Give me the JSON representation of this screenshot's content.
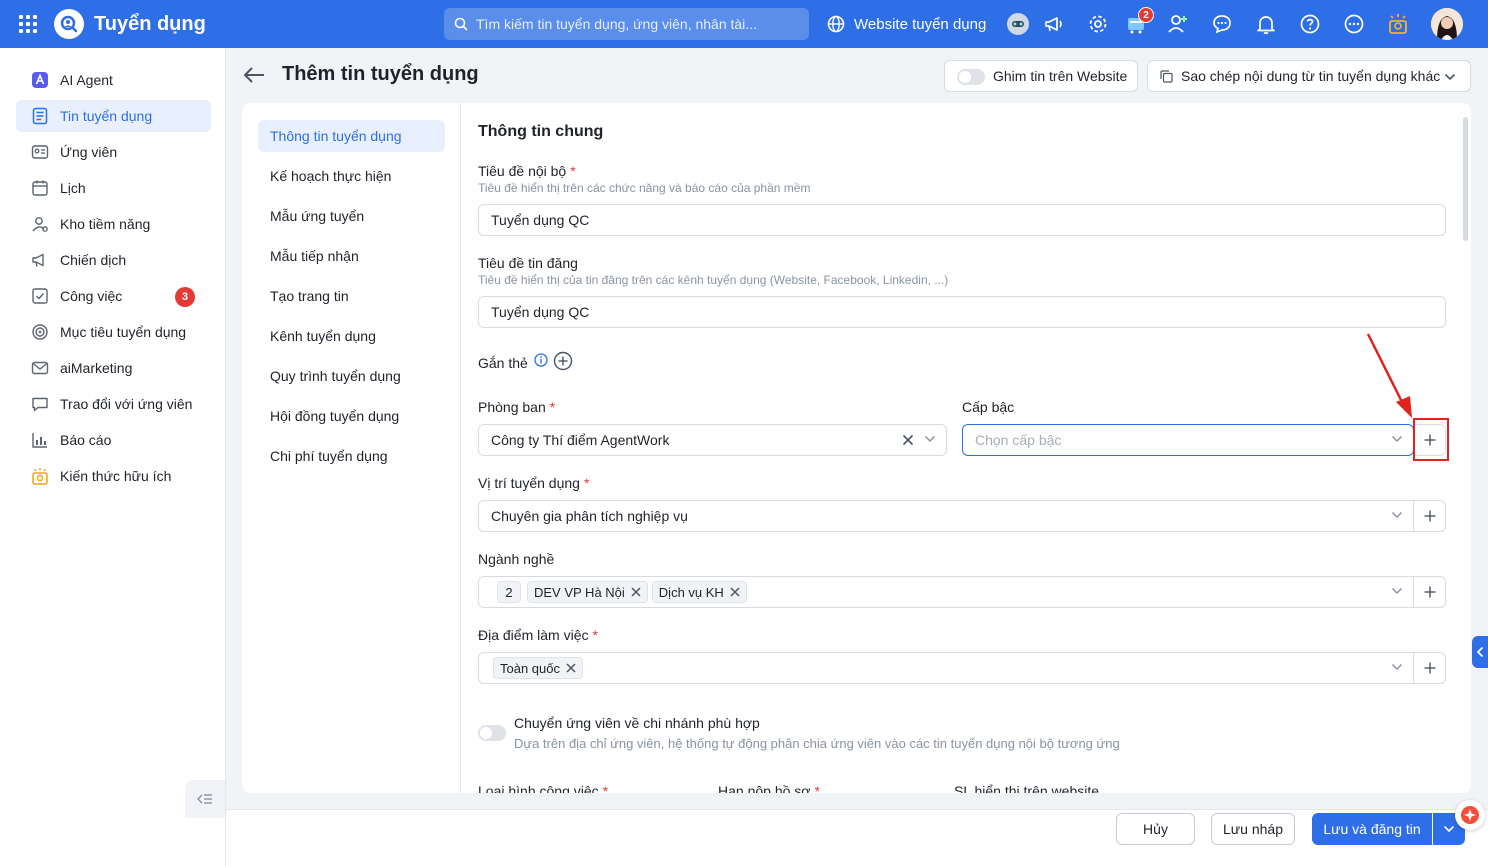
{
  "app": {
    "title": "Tuyển dụng"
  },
  "topbar": {
    "search_placeholder": "Tìm kiếm tin tuyển dụng, ứng viên, nhân tài...",
    "website_label": "Website tuyển dụng",
    "cart_badge": "2"
  },
  "sidebar": {
    "items": [
      {
        "label": "AI Agent",
        "icon": "ai-agent-icon"
      },
      {
        "label": "Tin tuyển dụng",
        "icon": "job-post-icon",
        "active": true
      },
      {
        "label": "Ứng viên",
        "icon": "candidate-icon"
      },
      {
        "label": "Lịch",
        "icon": "calendar-icon"
      },
      {
        "label": "Kho tiềm năng",
        "icon": "talent-pool-icon"
      },
      {
        "label": "Chiến dịch",
        "icon": "megaphone-icon"
      },
      {
        "label": "Công việc",
        "icon": "task-icon",
        "badge": "3"
      },
      {
        "label": "Mục tiêu tuyển dụng",
        "icon": "target-icon"
      },
      {
        "label": "aiMarketing",
        "icon": "mail-icon"
      },
      {
        "label": "Trao đổi với ứng viên",
        "icon": "chat-icon"
      },
      {
        "label": "Báo cáo",
        "icon": "report-icon"
      },
      {
        "label": "Kiến thức hữu ích",
        "icon": "lightbulb-icon"
      }
    ]
  },
  "header": {
    "title": "Thêm tin tuyển dụng",
    "pin_label": "Ghim tin trên Website",
    "copy_label": "Sao chép nội dung từ tin tuyển dụng khác"
  },
  "steps": [
    "Thông tin tuyển dụng",
    "Kế hoạch thực hiện",
    "Mẫu ứng tuyển",
    "Mẫu tiếp nhận",
    "Tạo trang tin",
    "Kênh tuyển dụng",
    "Quy trình tuyển dụng",
    "Hội đồng tuyển dụng",
    "Chi phí tuyển dụng"
  ],
  "form": {
    "section_title": "Thông tin chung",
    "internal_title": {
      "label": "Tiêu đề nội bộ",
      "hint": "Tiêu đề hiển thị trên các chức năng và báo cáo của phần mềm",
      "value": "Tuyển dụng QC"
    },
    "post_title": {
      "label": "Tiêu đề tin đăng",
      "hint": "Tiêu đề hiển thị của tin đăng trên các kênh tuyển dụng (Website, Facebook, Linkedin, ...)",
      "value": "Tuyển dụng QC"
    },
    "tags_label": "Gắn thẻ",
    "department": {
      "label": "Phòng ban",
      "value": "Công ty Thí điểm AgentWork"
    },
    "level": {
      "label": "Cấp bậc",
      "placeholder": "Chọn cấp bậc"
    },
    "position": {
      "label": "Vị trí tuyển dụng",
      "value": "Chuyên gia phân tích nghiệp vụ"
    },
    "industry": {
      "label": "Ngành nghề",
      "count": "2",
      "chips": [
        "DEV VP Hà Nội",
        "Dịch vụ KH"
      ]
    },
    "location": {
      "label": "Địa điểm làm việc",
      "chips": [
        "Toàn quốc"
      ]
    },
    "branch_switch": {
      "label": "Chuyển ứng viên về chi nhánh phù hợp",
      "desc": "Dựa trên địa chỉ ứng viên, hệ thống tự động phân chia ứng viên vào các tin tuyển dụng nội bộ tương ứng"
    },
    "bottom_labels": [
      "Loại hình công việc",
      "Hạn nộp hồ sơ",
      "SL hiển thị trên website"
    ]
  },
  "footer": {
    "cancel": "Hủy",
    "draft": "Lưu nháp",
    "save_publish": "Lưu và đăng tin"
  },
  "colors": {
    "primary": "#2e6ee6",
    "required": "#e53935",
    "highlight": "#e0231c"
  }
}
